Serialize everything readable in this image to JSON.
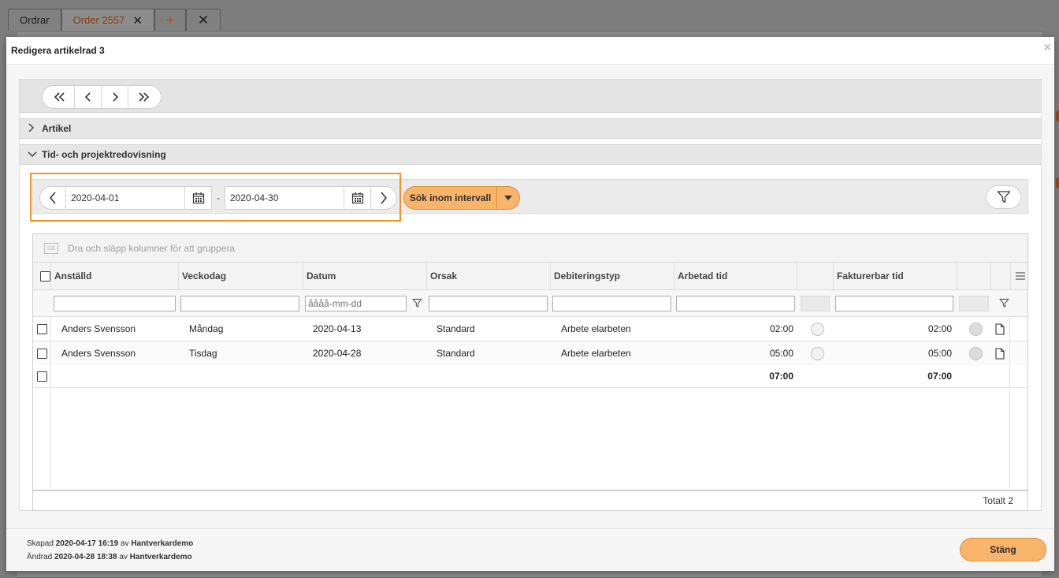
{
  "tabs": [
    {
      "label": "Ordrar"
    },
    {
      "label": "Order 2557",
      "close": "✕"
    }
  ],
  "tab_add": "+",
  "tab_close": "✕",
  "modal": {
    "title": "Redigera artikelrad 3",
    "close": "×"
  },
  "nav": {
    "first": "«",
    "prev": "‹",
    "next": "›",
    "last": "»"
  },
  "sections": {
    "artikel": "Artikel",
    "tid": "Tid- och projektredovisning"
  },
  "date_range": {
    "from": "2020-04-01",
    "to": "2020-04-30",
    "separator": "-"
  },
  "search_button": "Sök inom intervall",
  "grid": {
    "group_hint": "Dra och släpp kolumner för att gruppera",
    "columns": [
      "Anställd",
      "Veckodag",
      "Datum",
      "Orsak",
      "Debiteringstyp",
      "Arbetad tid",
      "Fakturerbar tid"
    ],
    "date_filter_placeholder": "åååå-mm-dd",
    "rows": [
      {
        "anstalld": "Anders Svensson",
        "veckodag": "Måndag",
        "datum": "2020-04-13",
        "orsak": "Standard",
        "debiteringstyp": "Arbete elarbeten",
        "arbetad": "02:00",
        "fakturerbar": "02:00"
      },
      {
        "anstalld": "Anders Svensson",
        "veckodag": "Tisdag",
        "datum": "2020-04-28",
        "orsak": "Standard",
        "debiteringstyp": "Arbete elarbeten",
        "arbetad": "05:00",
        "fakturerbar": "05:00"
      }
    ],
    "totals": {
      "arbetad": "07:00",
      "fakturerbar": "07:00"
    },
    "footer_total": "Totalt 2"
  },
  "meta": {
    "created_label": "Skapad",
    "created_time": "2020-04-17 16:19",
    "by": "av",
    "created_by": "Hantverkardemo",
    "changed_label": "Ändrad",
    "changed_time": "2020-04-28 18:38",
    "changed_by": "Hantverkardemo"
  },
  "close_button": "Stäng",
  "colors": {
    "accent": "#f9b46b",
    "highlight": "#f0922b",
    "active_tab_text": "#8a3d0c"
  }
}
